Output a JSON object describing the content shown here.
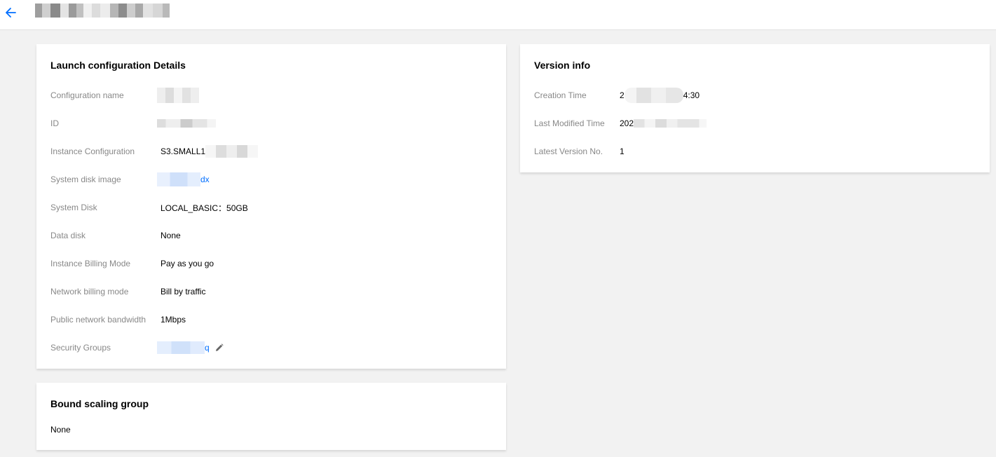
{
  "header": {
    "back_icon": "arrow-left-icon",
    "title_masked": true
  },
  "details": {
    "title": "Launch configuration Details",
    "rows": [
      {
        "label": "Configuration name",
        "value": "",
        "masked": true
      },
      {
        "label": "ID",
        "value": "",
        "masked": true
      },
      {
        "label": "Instance Configuration",
        "value": "S3.SMALL1",
        "masked": true
      },
      {
        "label": "System disk image",
        "value": "dx",
        "link": true,
        "masked": true
      },
      {
        "label": "System Disk",
        "value": "LOCAL_BASIC：50GB"
      },
      {
        "label": "Data disk",
        "value": "None"
      },
      {
        "label": "Instance Billing Mode",
        "value": "Pay as you go"
      },
      {
        "label": "Network billing mode",
        "value": "Bill by traffic"
      },
      {
        "label": "Public network bandwidth",
        "value": "1Mbps"
      },
      {
        "label": "Security Groups",
        "value": "q",
        "link": true,
        "masked": true,
        "edit_icon": "pencil-icon"
      }
    ]
  },
  "version": {
    "title": "Version info",
    "rows": [
      {
        "label": "Creation Time",
        "value_prefix": "2",
        "value_suffix": "4:30",
        "masked": true
      },
      {
        "label": "Last Modified Time",
        "value_prefix": "202",
        "masked": true
      },
      {
        "label": "Latest Version No.",
        "value": "1"
      }
    ]
  },
  "bound": {
    "title": "Bound scaling group",
    "value": "None"
  },
  "colors": {
    "link": "#006eff",
    "label": "#888888",
    "background": "#f2f2f2"
  }
}
